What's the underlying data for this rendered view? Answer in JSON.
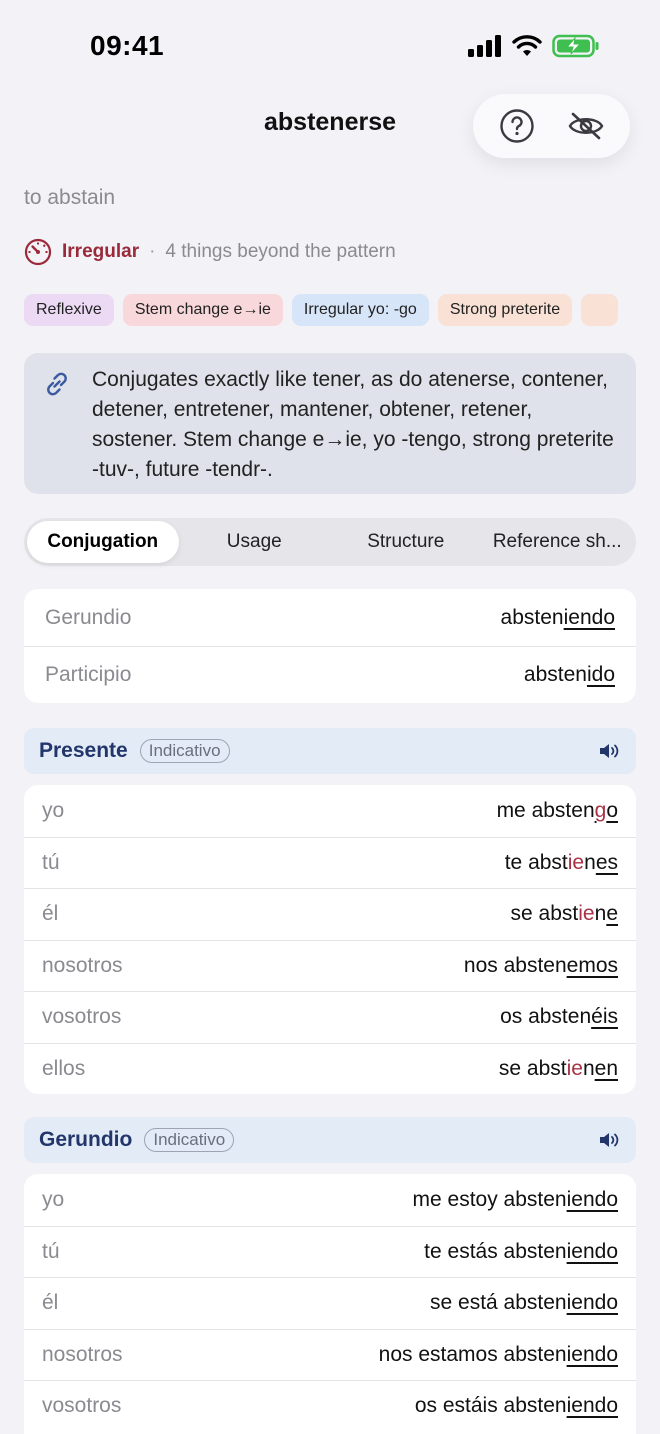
{
  "status_bar": {
    "time": "09:41"
  },
  "nav": {
    "title": "abstenerse",
    "help_icon": "question-circle-icon",
    "hide_icon": "eye-slash-icon"
  },
  "translation": "to abstain",
  "irregular": {
    "label": "Irregular",
    "separator": "·",
    "description": "4 things beyond the pattern"
  },
  "tags": [
    "Reflexive",
    "Stem change e→ie",
    "Irregular yo: -go",
    "Strong preterite"
  ],
  "note": {
    "text": "Conjugates exactly like tener, as do atenerse, contener, detener, entretener, mantener, obtener, retener, sostener. Stem change e→ie, yo -tengo, strong preterite -tuv-, future -tendr-."
  },
  "tabs": [
    "Conjugation",
    "Usage",
    "Structure",
    "Reference sh..."
  ],
  "forms": [
    {
      "label": "Gerundio",
      "stem": "absten",
      "ending": "iendo"
    },
    {
      "label": "Participio",
      "stem": "absten",
      "ending": "ido"
    }
  ],
  "tenses": [
    {
      "name": "Presente",
      "mood": "Indicativo",
      "rows": [
        {
          "pronoun": "yo",
          "pre": "me absten",
          "irr": "g",
          "end": "o"
        },
        {
          "pronoun": "tú",
          "pre": "te abst",
          "irr": "ie",
          "mid": "n",
          "end": "es"
        },
        {
          "pronoun": "él",
          "pre": "se abst",
          "irr": "ie",
          "mid": "n",
          "end": "e"
        },
        {
          "pronoun": "nosotros",
          "pre": "nos absten",
          "end": "emos"
        },
        {
          "pronoun": "vosotros",
          "pre": "os absten",
          "end": "éis"
        },
        {
          "pronoun": "ellos",
          "pre": "se abst",
          "irr": "ie",
          "mid": "n",
          "end": "en"
        }
      ]
    },
    {
      "name": "Gerundio",
      "mood": "Indicativo",
      "rows": [
        {
          "pronoun": "yo",
          "pre": "me estoy absten",
          "end": "iendo"
        },
        {
          "pronoun": "tú",
          "pre": "te estás absten",
          "end": "iendo"
        },
        {
          "pronoun": "él",
          "pre": "se está absten",
          "end": "iendo"
        },
        {
          "pronoun": "nosotros",
          "pre": "nos estamos absten",
          "end": "iendo"
        },
        {
          "pronoun": "vosotros",
          "pre": "os estáis absten",
          "end": "iendo"
        }
      ]
    }
  ]
}
